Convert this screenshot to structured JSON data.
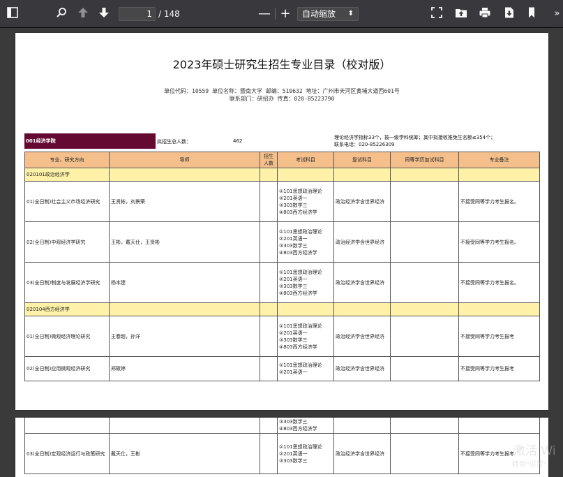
{
  "toolbar": {
    "page_current": "1",
    "page_total": "/ 148",
    "zoom_out": "—",
    "zoom_in": "+",
    "zoom_value": "自动缩放",
    "zoom_arrow": "⬍",
    "more": "»"
  },
  "document": {
    "title": "2023年硕士研究生招生专业目录（校对版）",
    "unit_line": "单位代码：10559  单位名称：暨南大学  邮编：510632  地址：广州市天河区黄埔大道西601号",
    "contact_line": "联系部门：研招办   传真：020-85223790",
    "department": "001经济学院",
    "plan_label": "拟招生总人数：",
    "plan_value": "462",
    "quota_note_1": "理论经济学指标33个，按一级学科统筹；其中拟接收推免生名额≤354个；",
    "quota_note_2": "联系电话：020-85226309"
  },
  "table": {
    "headers": [
      "专业、研究方向",
      "导师",
      "招生人数",
      "考试科目",
      "复试科目",
      "同等学历加试科目",
      "专业备注"
    ],
    "rows": [
      {
        "type": "major",
        "name": "020101政治经济学"
      },
      {
        "type": "dir",
        "name": "01(全日制)社会主义市场经济研究",
        "advisor": "王贤彬，刘景荣",
        "count": "",
        "exam": [
          "①101思想政治理论",
          "②201英语一",
          "③303数学三",
          "④803西方经济学"
        ],
        "retest": "政治经济学含世界经济",
        "extra": "",
        "note": "不接受同等学力考生报名。"
      },
      {
        "type": "dir",
        "name": "02(全日制)中观经济学研究",
        "advisor": "王彬，戴天仕，王贤彬",
        "count": "",
        "exam": [
          "①101思想政治理论",
          "②201英语一",
          "③303数学三",
          "④803西方经济学"
        ],
        "retest": "政治经济学含世界经济",
        "extra": "",
        "note": "不接受同等学力考生报名。"
      },
      {
        "type": "dir",
        "name": "03(全日制)制度与发展经济学研究",
        "advisor": "杨本建",
        "count": "",
        "exam": [
          "①101思想政治理论",
          "②201英语一",
          "③303数学三",
          "④803西方经济学"
        ],
        "retest": "政治经济学含世界经济",
        "extra": "",
        "note": "不接受同等学力考生报名。"
      },
      {
        "type": "major",
        "name": "020104西方经济学"
      },
      {
        "type": "dir",
        "name": "01(全日制)微观经济理论研究",
        "advisor": "王春超，孙洋",
        "count": "",
        "exam": [
          "①101思想政治理论",
          "②201英语一",
          "③303数学三",
          "④803西方经济学"
        ],
        "retest": "政治经济学含世界经济",
        "extra": "",
        "note": "不接受同等学力考生报考"
      },
      {
        "type": "dir-short",
        "name": "02(全日制)应用微观经济研究",
        "advisor": "郑筱婷",
        "count": "",
        "exam": [
          "①101思想政治理论",
          "②201英语一"
        ],
        "retest": "政治经济学含世界经济",
        "extra": "",
        "note": "不接受同等学力考生报考"
      }
    ],
    "page2_rows": [
      {
        "type": "cont",
        "name": "",
        "advisor": "",
        "count": "",
        "exam": [
          "③303数学三",
          "④803西方经济学"
        ],
        "retest": "",
        "extra": "",
        "note": ""
      },
      {
        "type": "dir",
        "name": "03(全日制)宏观经济运行与政策研究",
        "advisor": "戴天仕，王彬",
        "count": "",
        "exam": [
          "①101思想政治理论",
          "②201英语一",
          "③303数学三"
        ],
        "retest": "政治经济学含世界经济",
        "extra": "",
        "note": "不接受同等学力考生报考"
      }
    ]
  },
  "watermark": {
    "line1": "激活 Wi",
    "line2": "转到\"设置\""
  }
}
